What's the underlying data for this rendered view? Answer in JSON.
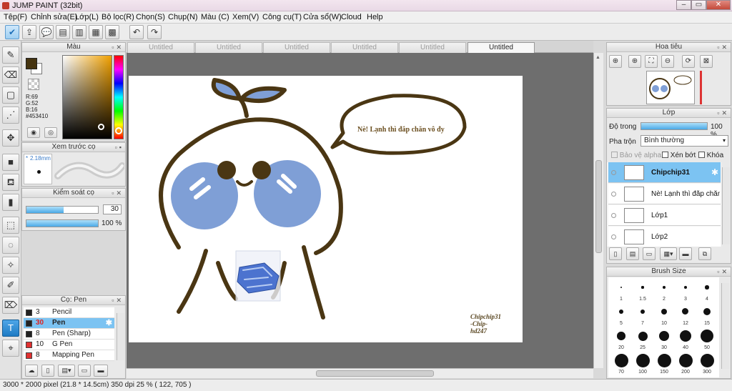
{
  "window": {
    "title": "JUMP PAINT (32bit)",
    "controls": {
      "minimize": "–",
      "maximize": "▭",
      "close": "✕"
    }
  },
  "menu": [
    "Tệp(F)",
    "Chỉnh sửa(E)",
    "Lớp(L)",
    "Bộ lọc(R)",
    "Chọn(S)",
    "Chụp(N)",
    "Màu (C)",
    "Xem(V)",
    "Công cụ(T)",
    "Cửa sổ(W)",
    "Cloud",
    "Help"
  ],
  "toolbar": {
    "icons": [
      "check-icon",
      "share-icon",
      "comment-icon",
      "speech-icon",
      "document-icon",
      "page-icon",
      "grid-icon",
      "layout-icon"
    ],
    "undo_icon": "undo-icon",
    "redo_icon": "redo-icon"
  },
  "doc_tabs": [
    "Untitled",
    "Untitled",
    "Untitled",
    "Untitled",
    "Untitled",
    "Untitled"
  ],
  "color_panel": {
    "title": "Màu",
    "fg_color": "#453410",
    "readout_r": "R:69",
    "readout_g": "G:52",
    "readout_b": "B:16",
    "hex": "#453410"
  },
  "brush_preview": {
    "title": "Xem trước cọ",
    "size_label": "2.18mm"
  },
  "brush_control": {
    "title": "Kiểm soát cọ",
    "size_value": "30",
    "opacity_value": "100 %",
    "size_fraction": 0.52,
    "opacity_fraction": 1.0
  },
  "pen_panel": {
    "title": "Cọ: Pen",
    "items": [
      {
        "size": "3",
        "name": "Pencil",
        "color": "#222222"
      },
      {
        "size": "30",
        "name": "Pen",
        "color": "#222222",
        "selected": true
      },
      {
        "size": "8",
        "name": "Pen (Sharp)",
        "color": "#222222"
      },
      {
        "size": "10",
        "name": "G Pen",
        "color": "#e03030"
      },
      {
        "size": "8",
        "name": "Mapping Pen",
        "color": "#e03030"
      }
    ]
  },
  "navigator": {
    "title": "Hoa tiêu"
  },
  "layer_panel": {
    "title": "Lớp",
    "opacity_label": "Độ trong",
    "opacity_value": "100 %",
    "opacity_fraction": 1.0,
    "blend_label": "Pha trộn",
    "blend_value": "Bình thường",
    "protect_alpha": "Bảo vệ alpha",
    "clipping": "Xén bớt",
    "lock": "Khóa",
    "layers": [
      {
        "name": "Chipchip31",
        "selected": true
      },
      {
        "name": "Nè! Lạnh thì đắp chăn vô đy",
        "selected": false
      },
      {
        "name": "Lớp1",
        "selected": false
      },
      {
        "name": "Lớp2",
        "selected": false
      }
    ]
  },
  "brush_size_panel": {
    "title": "Brush Size",
    "sizes": [
      "1",
      "1.5",
      "2",
      "3",
      "4",
      "5",
      "7",
      "10",
      "12",
      "15",
      "20",
      "25",
      "30",
      "40",
      "50",
      "70",
      "100",
      "150",
      "200",
      "300"
    ]
  },
  "canvas": {
    "speech_text": "Nè! Lạnh thì đắp chăn vô đy",
    "signature_lines": [
      "Chipchip31",
      "-Chip-",
      "hd247"
    ],
    "outline_color": "#4a3613",
    "cheek_color": "#7f9fd6"
  },
  "status": {
    "text": "3000 * 2000 pixel  (21.8 * 14.5cm)  350 dpi  25 %  ( 122, 705 )"
  }
}
